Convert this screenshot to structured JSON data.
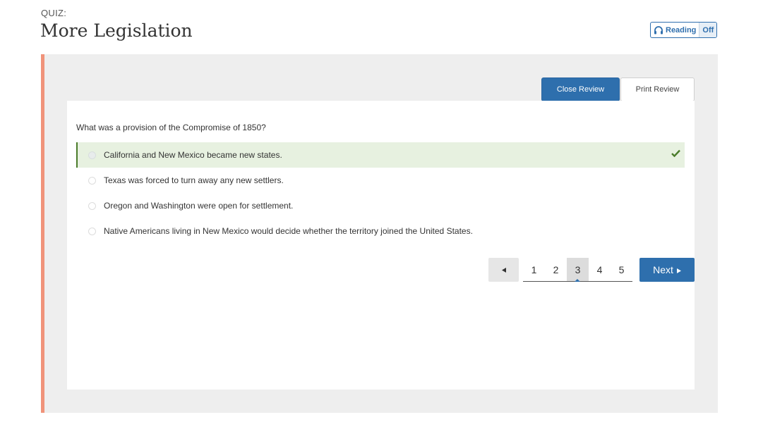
{
  "header": {
    "kicker": "QUIZ:",
    "title": "More Legislation",
    "reading_label": "Reading",
    "reading_state": "Off",
    "reading_icon": "headphones-icon"
  },
  "review": {
    "close_label": "Close Review",
    "print_label": "Print Review"
  },
  "question": {
    "text": "What was a provision of the Compromise of 1850?",
    "answers": [
      {
        "label": "California and New Mexico became new states.",
        "correct": true
      },
      {
        "label": "Texas was forced to turn away any new settlers.",
        "correct": false
      },
      {
        "label": "Oregon and Washington were open for settlement.",
        "correct": false
      },
      {
        "label": "Native Americans living in New Mexico would decide whether the territory joined the United States.",
        "correct": false
      }
    ]
  },
  "pagination": {
    "prev_icon": "triangle-left-icon",
    "pages": [
      "1",
      "2",
      "3",
      "4",
      "5"
    ],
    "current_page": "3",
    "next_label": "Next",
    "next_icon": "triangle-right-icon"
  },
  "colors": {
    "accent": "#f0937a",
    "primary": "#2e6fad",
    "correct_bg": "#e7f1e0",
    "correct_mark": "#4a7c2a"
  }
}
